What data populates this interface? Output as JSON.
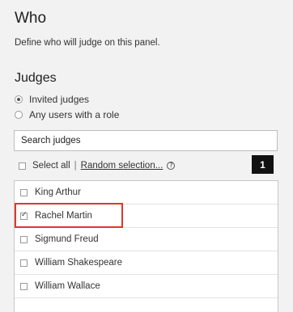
{
  "header": {
    "title": "Who",
    "description": "Define who will judge on this panel."
  },
  "judges": {
    "section_title": "Judges",
    "options": [
      {
        "label": "Invited judges",
        "selected": true
      },
      {
        "label": "Any users with a role",
        "selected": false
      }
    ],
    "search": {
      "value": "Search judges",
      "placeholder": "Search judges"
    },
    "select_all_label": "Select all",
    "separator": "|",
    "random_selection_label": "Random selection...",
    "help_icon": "?",
    "selected_count": "1",
    "list": [
      {
        "name": "King Arthur",
        "checked": false
      },
      {
        "name": "Rachel Martin",
        "checked": true
      },
      {
        "name": "Sigmund Freud",
        "checked": false
      },
      {
        "name": "William Shakespeare",
        "checked": false
      },
      {
        "name": "William Wallace",
        "checked": false
      }
    ]
  },
  "colors": {
    "background": "#f2f2f2",
    "highlight": "#e0362b",
    "badge": "#111111"
  }
}
